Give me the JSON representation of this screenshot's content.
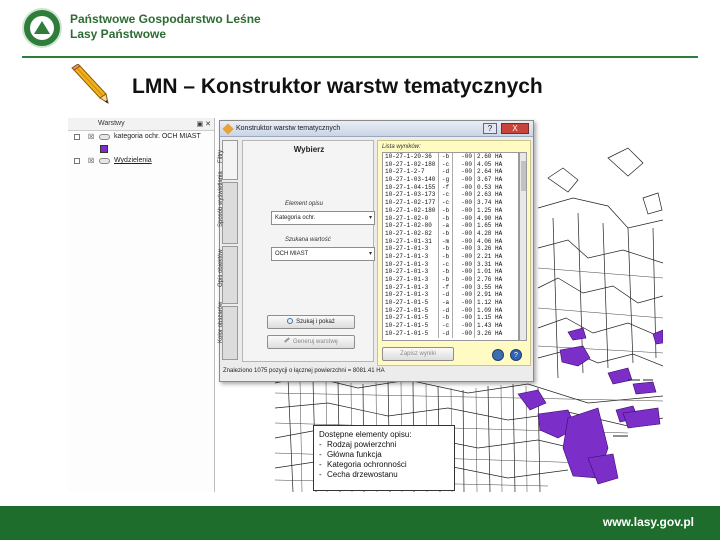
{
  "header": {
    "org_line1": "Państwowe Gospodarstwo Leśne",
    "org_line2": "Lasy Państwowe",
    "title": "LMN – Konstruktor warstw tematycznych"
  },
  "layers_panel": {
    "title": "Warstwy",
    "items": [
      {
        "label": "kategoria ochr. OCH MIAST"
      },
      {
        "label": "Wydzielenia"
      }
    ]
  },
  "dialog": {
    "title": "Konstruktor warstw tematycznych",
    "help_label": "?",
    "close_label": "X",
    "tabs": [
      "Filtry",
      "Sposób wyświetlania",
      "Opis obiektów",
      "Kolor obszarów"
    ],
    "left": {
      "heading": "Wybierz",
      "element_label": "Element opisu",
      "element_value": "Kategoria ochr.",
      "value_label": "Szukana wartość",
      "value_value": "OCH MIAST",
      "search_button": "Szukaj i pokaż",
      "save_button": "Generuj warstwę"
    },
    "right": {
      "list_label": "Lista wyników:",
      "rows": [
        [
          "10-27-1-20-36",
          "-b",
          "-00",
          "2.60 HA"
        ],
        [
          "10-27-1-02-180",
          "-c",
          "-00",
          "4.05 HA"
        ],
        [
          "10-27-1-2-7",
          "-d",
          "-00",
          "2.64 HA"
        ],
        [
          "10-27-1-03-140",
          "-g",
          "-00",
          "3.67 HA"
        ],
        [
          "10-27-1-04-155",
          "-f",
          "-00",
          "0.53 HA"
        ],
        [
          "10-27-1-03-173",
          "-c",
          "-00",
          "2.63 HA"
        ],
        [
          "10-27-1-02-177",
          "-c",
          "-00",
          "3.74 HA"
        ],
        [
          "10-27-1-02-180",
          "-b",
          "-00",
          "1.25 HA"
        ],
        [
          "10-27-1-02-0",
          "-b",
          "-00",
          "4.90 HA"
        ],
        [
          "10-27-1-02-80",
          "-a",
          "-00",
          "1.65 HA"
        ],
        [
          "10-27-1-02-82",
          "-b",
          "-00",
          "4.28 HA"
        ],
        [
          "10-27-1-01-31",
          "-m",
          "-00",
          "4.06 HA"
        ],
        [
          "10-27-1-01-3",
          "-b",
          "-00",
          "3.26 HA"
        ],
        [
          "10-27-1-01-3",
          "-b",
          "-00",
          "2.21 HA"
        ],
        [
          "10-27-1-01-3",
          "-c",
          "-00",
          "3.31 HA"
        ],
        [
          "10-27-1-01-3",
          "-b",
          "-00",
          "1.01 HA"
        ],
        [
          "10-27-1-01-3",
          "-b",
          "-00",
          "2.76 HA"
        ],
        [
          "10-27-1-01-3",
          "-f",
          "-00",
          "3.55 HA"
        ],
        [
          "10-27-1-01-3",
          "-d",
          "-00",
          "2.91 HA"
        ],
        [
          "10-27-1-01-5",
          "-a",
          "-00",
          "1.12 HA"
        ],
        [
          "10-27-1-01-5",
          "-d",
          "-00",
          "1.09 HA"
        ],
        [
          "10-27-1-01-5",
          "-b",
          "-00",
          "1.15 HA"
        ],
        [
          "10-27-1-01-5",
          "-c",
          "-00",
          "1.43 HA"
        ],
        [
          "10-27-1-01-5",
          "-d",
          "-00",
          "3.26 HA"
        ]
      ],
      "export_button": "Zapisz wyniki"
    },
    "status": "Znaleziono 1075 pozycji o łącznej powierzchni = 8081.41 HA"
  },
  "infobox": {
    "heading": "Dostępne elementy opisu:",
    "items": [
      "Rodzaj powierzchni",
      "Główna funkcja",
      "Kategoria ochronności",
      "Cecha drzewostanu"
    ]
  },
  "footer": {
    "url": "www.lasy.gov.pl"
  },
  "colors": {
    "brand_green": "#1f6d2c",
    "highlight_purple": "#7b2fc8",
    "list_bg_yellow": "#fffbc2"
  }
}
